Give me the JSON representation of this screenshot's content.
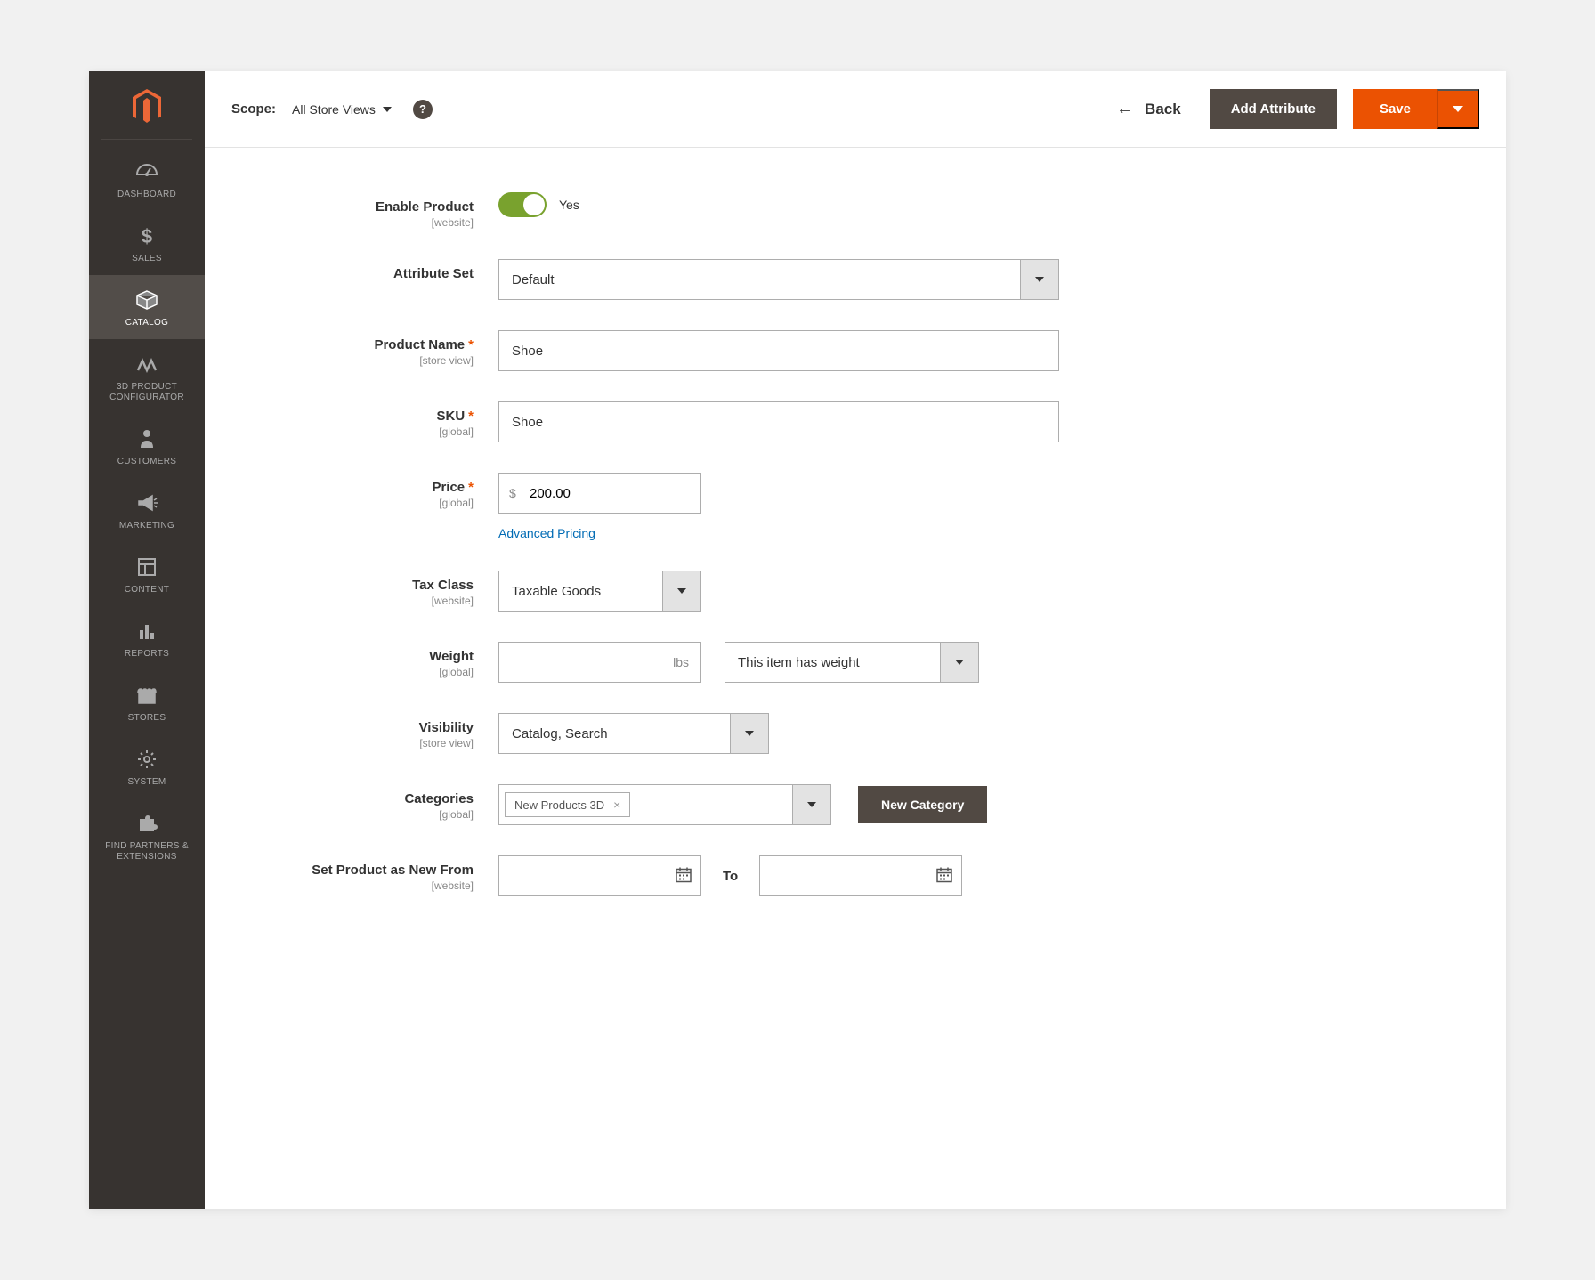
{
  "sidebar": {
    "items": [
      {
        "label": "DASHBOARD",
        "icon": "dashboard"
      },
      {
        "label": "SALES",
        "icon": "sales"
      },
      {
        "label": "CATALOG",
        "icon": "catalog",
        "active": true
      },
      {
        "label": "3D PRODUCT CONFIGURATOR",
        "icon": "3d"
      },
      {
        "label": "CUSTOMERS",
        "icon": "customers"
      },
      {
        "label": "MARKETING",
        "icon": "marketing"
      },
      {
        "label": "CONTENT",
        "icon": "content"
      },
      {
        "label": "REPORTS",
        "icon": "reports"
      },
      {
        "label": "STORES",
        "icon": "stores"
      },
      {
        "label": "SYSTEM",
        "icon": "system"
      },
      {
        "label": "FIND PARTNERS & EXTENSIONS",
        "icon": "partners"
      }
    ]
  },
  "topbar": {
    "scope_label": "Scope:",
    "scope_value": "All Store Views",
    "back_label": "Back",
    "add_attribute_label": "Add Attribute",
    "save_label": "Save"
  },
  "form": {
    "enable_product": {
      "label": "Enable Product",
      "scope": "[website]",
      "value_label": "Yes",
      "enabled": true
    },
    "attribute_set": {
      "label": "Attribute Set",
      "value": "Default"
    },
    "product_name": {
      "label": "Product Name",
      "scope": "[store view]",
      "required": true,
      "value": "Shoe"
    },
    "sku": {
      "label": "SKU",
      "scope": "[global]",
      "required": true,
      "value": "Shoe"
    },
    "price": {
      "label": "Price",
      "scope": "[global]",
      "required": true,
      "currency": "$",
      "value": "200.00",
      "advanced_link": "Advanced Pricing"
    },
    "tax_class": {
      "label": "Tax Class",
      "scope": "[website]",
      "value": "Taxable Goods"
    },
    "weight": {
      "label": "Weight",
      "scope": "[global]",
      "unit": "lbs",
      "value": "",
      "has_weight": "This item has weight"
    },
    "visibility": {
      "label": "Visibility",
      "scope": "[store view]",
      "value": "Catalog, Search"
    },
    "categories": {
      "label": "Categories",
      "scope": "[global]",
      "chip": "New Products 3D",
      "new_category_label": "New Category"
    },
    "new_from": {
      "label": "Set Product as New From",
      "scope": "[website]",
      "from_value": "",
      "to_label": "To",
      "to_value": ""
    }
  },
  "colors": {
    "accent": "#eb5202",
    "sidebar_bg": "#373330",
    "toggle_on": "#79a22e",
    "link": "#006bb4"
  }
}
